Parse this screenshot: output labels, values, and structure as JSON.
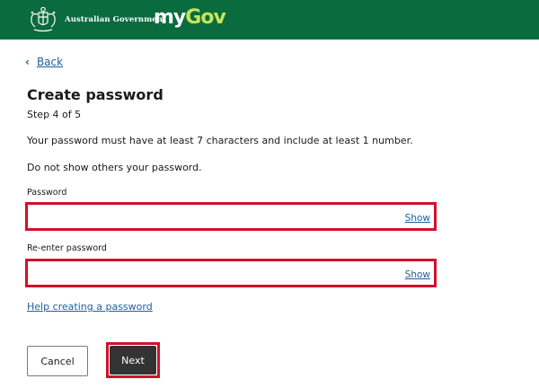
{
  "header": {
    "gov_name": "Australian Government",
    "logo_my": "my",
    "logo_gov": "Gov",
    "bg_color": "#0a6b3e",
    "logo_accent": "#c5e45a"
  },
  "nav": {
    "back_icon": "chevron-left-icon",
    "back_label": "Back"
  },
  "main": {
    "title": "Create password",
    "step": "Step 4 of 5",
    "info_rule": "Your password must have at least 7 characters and include at least 1 number.",
    "info_secret": "Do not show others your password.",
    "password": {
      "label": "Password",
      "value": "",
      "toggle_label": "Show"
    },
    "confirm_password": {
      "label": "Re-enter password",
      "value": "",
      "toggle_label": "Show"
    },
    "help_link": "Help creating a password",
    "cancel_label": "Cancel",
    "next_label": "Next",
    "highlight_color": "#d0112b",
    "link_color": "#1e5e9c"
  }
}
